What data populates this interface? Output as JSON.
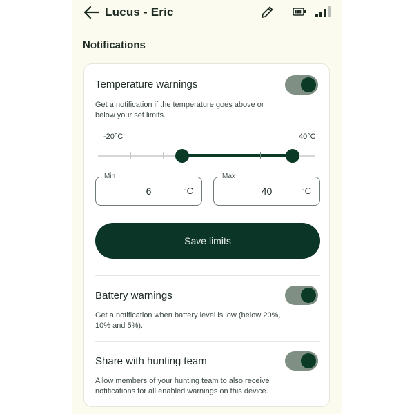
{
  "header": {
    "title": "Lucus - Eric",
    "back_icon": "arrow-left-icon",
    "edit_icon": "pencil-icon",
    "battery_icon": "battery-icon",
    "signal_icon": "signal-bars-icon"
  },
  "section": {
    "title": "Notifications"
  },
  "temperature": {
    "title": "Temperature warnings",
    "description": "Get a notification if the temperature goes above or below your set limits.",
    "enabled": true,
    "range_min_label": "-20°C",
    "range_max_label": "40°C",
    "range_min": -20,
    "range_max": 40,
    "selected_min": 6,
    "selected_max": 40,
    "min_field": {
      "legend": "Min",
      "value": "6",
      "unit": "°C"
    },
    "max_field": {
      "legend": "Max",
      "value": "40",
      "unit": "°C"
    },
    "save_label": "Save limits"
  },
  "battery": {
    "title": "Battery warnings",
    "description": "Get a notification when battery level is low (below 20%, 10% and 5%).",
    "enabled": true
  },
  "share": {
    "title": "Share with hunting team",
    "description": "Allow members of your hunting team to also receive notifications for all enabled warnings on this device.",
    "enabled": true
  },
  "colors": {
    "background": "#fbfbf0",
    "accent": "#0b3a27",
    "toggle_track": "#7f8f84"
  }
}
